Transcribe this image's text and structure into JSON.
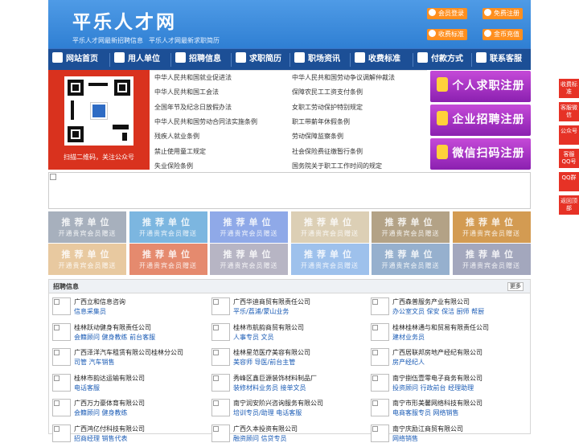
{
  "header": {
    "title": "平乐人才网",
    "subtitle1": "平乐人才网最新招聘信息",
    "subtitle2": "平乐人才网最新求职简历",
    "buttons": {
      "member_login": "会员登录",
      "free_register": "免费注册",
      "fee_standard": "收费标准",
      "gold_recharge": "金币充值"
    }
  },
  "nav": [
    "网站首页",
    "用人单位",
    "招聘信息",
    "求职简历",
    "职场资讯",
    "收费标准",
    "付款方式",
    "联系客服"
  ],
  "qr": {
    "caption": "扫描二维码，关注公众号"
  },
  "links": {
    "left": [
      "中华人民共和国就业促进法",
      "中华人民共和国工会法",
      "全国年节及纪念日放假办法",
      "中华人民共和国劳动合同法实施条例",
      "残疾人就业条例",
      "禁止使用童工规定",
      "失业保险条例"
    ],
    "right": [
      "中华人民共和国劳动争议调解仲裁法",
      "保障农民工工资支付条例",
      "女职工劳动保护特别规定",
      "职工带薪年休假条例",
      "劳动保障监察条例",
      "社会保险费征缴暂行条例",
      "国务院关于职工工作时间的规定"
    ]
  },
  "register": {
    "personal": "个人求职注册",
    "company": "企业招聘注册",
    "wechat": "微信扫码注册"
  },
  "recommend": {
    "title": "推荐单位",
    "subtitle": "开通贵宾会员赠送",
    "colors": [
      "#a7b0bd",
      "#7cb6e0",
      "#8fa9e8",
      "#dccfb5",
      "#b3a286",
      "#d39b52",
      "#e8c9a0",
      "#e58a6e",
      "#b7b5c4",
      "#9ec1ec",
      "#96b0ce",
      "#a3a7bd"
    ]
  },
  "jobs": {
    "title": "招聘信息",
    "more": "更多",
    "items": [
      {
        "company": "广西立和信息咨询",
        "positions": "信息采集员"
      },
      {
        "company": "广西华迪商贸有限责任公司",
        "positions": "平乐/荔浦/蒙山业务"
      },
      {
        "company": "广西森普服务产业有限公司",
        "positions": "办公室文员 保安 保洁 厨师 帮厨"
      },
      {
        "company": "桂林跃动健身有限责任公司",
        "positions": "会籍顾问 健身教练 前台客服"
      },
      {
        "company": "桂林市航韵商贸有限公司",
        "positions": "人事专员 文员"
      },
      {
        "company": "桂林桂林通与和贸易有限责任公司",
        "positions": "建材业务员"
      },
      {
        "company": "广西泽洋汽车租赁有限公司桂林分公司",
        "positions": "司管 汽车销售"
      },
      {
        "company": "桂林星范医疗美容有限公司",
        "positions": "美容师 导医/前台主管"
      },
      {
        "company": "广西居联邦房地产经纪有限公司",
        "positions": "房产经纪人"
      },
      {
        "company": "桂林市韵达运输有限公司",
        "positions": "电话客服"
      },
      {
        "company": "秀峰区鑫巨源装饰材料制品厂",
        "positions": "装修材料业务员 接单文员"
      },
      {
        "company": "南宁捌伍壹零电子商务有限公司",
        "positions": "投资顾问 行政前台 经理助理"
      },
      {
        "company": "广西万力豪体育有限公司",
        "positions": "会籍顾问 健身教练"
      },
      {
        "company": "南宁润安阶兴咨询服务有限公司",
        "positions": "培训专员/助理 电话客服"
      },
      {
        "company": "南宁市形美馨网络科技有限公司",
        "positions": "电商客服专员 网络销售"
      },
      {
        "company": "广西鸿亿付科技有限公司",
        "positions": "招商经理 销售代表"
      },
      {
        "company": "广西久本投资有限公司",
        "positions": "融资顾问 信贷专员"
      },
      {
        "company": "南宁庆励江商贸有限公司",
        "positions": "网络销售"
      }
    ]
  },
  "side": [
    "收费标准",
    "客服微信",
    "公众号",
    "客服QQ号",
    "QQ群",
    "返回顶部"
  ]
}
